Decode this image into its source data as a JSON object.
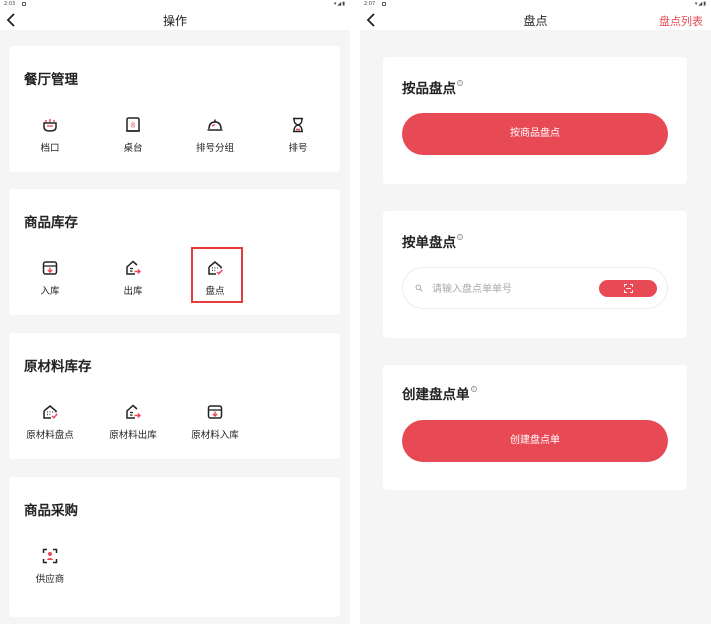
{
  "left": {
    "status": {
      "time": "2:03",
      "icons": "▾◢▮"
    },
    "nav": {
      "title": "操作",
      "back_icon": "chevron-left-icon"
    },
    "sections": [
      {
        "title": "餐厅管理",
        "items": [
          {
            "label": "档口",
            "icon": "stall-icon"
          },
          {
            "label": "桌台",
            "icon": "table-icon"
          },
          {
            "label": "排号分组",
            "icon": "bell-icon"
          },
          {
            "label": "排号",
            "icon": "hourglass-icon"
          }
        ]
      },
      {
        "title": "商品库存",
        "items": [
          {
            "label": "入库",
            "icon": "inbox-down-icon"
          },
          {
            "label": "出库",
            "icon": "outbox-icon"
          },
          {
            "label": "盘点",
            "icon": "stocktake-icon"
          }
        ]
      },
      {
        "title": "原材料库存",
        "items": [
          {
            "label": "原材料盘点",
            "icon": "stocktake-icon"
          },
          {
            "label": "原材料出库",
            "icon": "outbox-icon"
          },
          {
            "label": "原材料入库",
            "icon": "inbox-down-icon"
          }
        ]
      },
      {
        "title": "商品采购",
        "items": [
          {
            "label": "供应商",
            "icon": "supplier-icon"
          }
        ]
      }
    ]
  },
  "right": {
    "status": {
      "time": "2:07",
      "icons": "▾◢▮"
    },
    "nav": {
      "title": "盘点",
      "action": "盘点列表",
      "back_icon": "chevron-left-icon"
    },
    "by_product": {
      "title": "按品盘点",
      "button": "按商品盘点"
    },
    "by_order": {
      "title": "按单盘点",
      "placeholder": "请输入盘点单单号"
    },
    "create": {
      "title": "创建盘点单",
      "button": "创建盘点单"
    }
  },
  "colors": {
    "accent": "#e84a55",
    "highlight": "#e63b3b",
    "background": "#f5f5f5"
  }
}
